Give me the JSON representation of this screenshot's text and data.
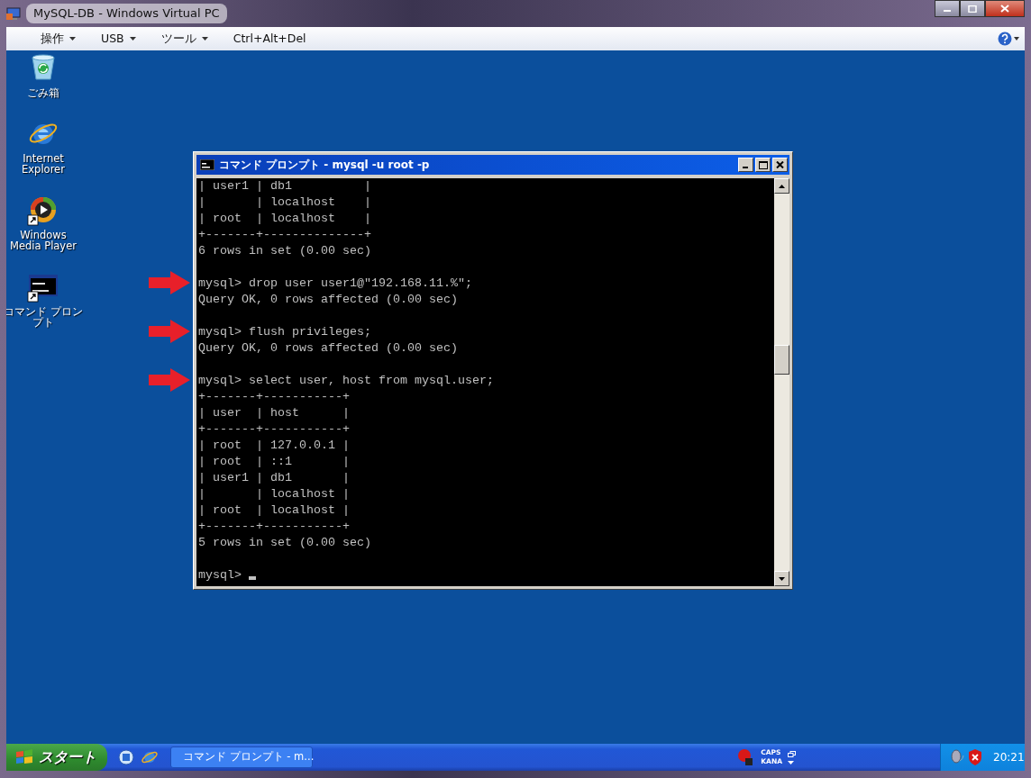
{
  "window": {
    "title": "MySQL-DB - Windows Virtual PC"
  },
  "menu": [
    {
      "label": "操作",
      "dropdown": true
    },
    {
      "label": "USB",
      "dropdown": true
    },
    {
      "label": "ツール",
      "dropdown": true
    },
    {
      "label": "Ctrl+Alt+Del",
      "dropdown": false
    }
  ],
  "desktop_icons": [
    {
      "label": "ごみ箱",
      "kind": "recycle",
      "shortcut": false
    },
    {
      "label": "Internet Explorer",
      "kind": "browser",
      "shortcut": false
    },
    {
      "label": "Windows Media Player",
      "kind": "media",
      "shortcut": true
    },
    {
      "label": "コマンド プロンプト",
      "kind": "console",
      "shortcut": true
    }
  ],
  "console": {
    "title": "コマンド プロンプト - mysql -u root -p",
    "blocks": [
      {
        "marked": false,
        "cursor": false,
        "lines": [
          "| user1 | db1          |",
          "|       | localhost    |",
          "| root  | localhost    |",
          "+-------+--------------+",
          "6 rows in set (0.00 sec)"
        ]
      },
      {
        "marked": true,
        "cursor": false,
        "lines": [
          "mysql> drop user user1@\"192.168.11.%\";",
          "Query OK, 0 rows affected (0.00 sec)"
        ]
      },
      {
        "marked": true,
        "cursor": false,
        "lines": [
          "mysql> flush privileges;",
          "Query OK, 0 rows affected (0.00 sec)"
        ]
      },
      {
        "marked": true,
        "cursor": false,
        "lines": [
          "mysql> select user, host from mysql.user;",
          "+-------+-----------+",
          "| user  | host      |",
          "+-------+-----------+",
          "| root  | 127.0.0.1 |",
          "| root  | ::1       |",
          "| user1 | db1       |",
          "|       | localhost |",
          "| root  | localhost |",
          "+-------+-----------+",
          "5 rows in set (0.00 sec)"
        ]
      },
      {
        "marked": false,
        "cursor": true,
        "lines": [
          "mysql>"
        ]
      }
    ]
  },
  "taskbar": {
    "start": "スタート",
    "tasks": [
      {
        "label": "コマンド プロンプト - m...",
        "selected": false
      }
    ],
    "language": [
      "CAPS",
      "KANA"
    ],
    "clock": "20:21"
  }
}
